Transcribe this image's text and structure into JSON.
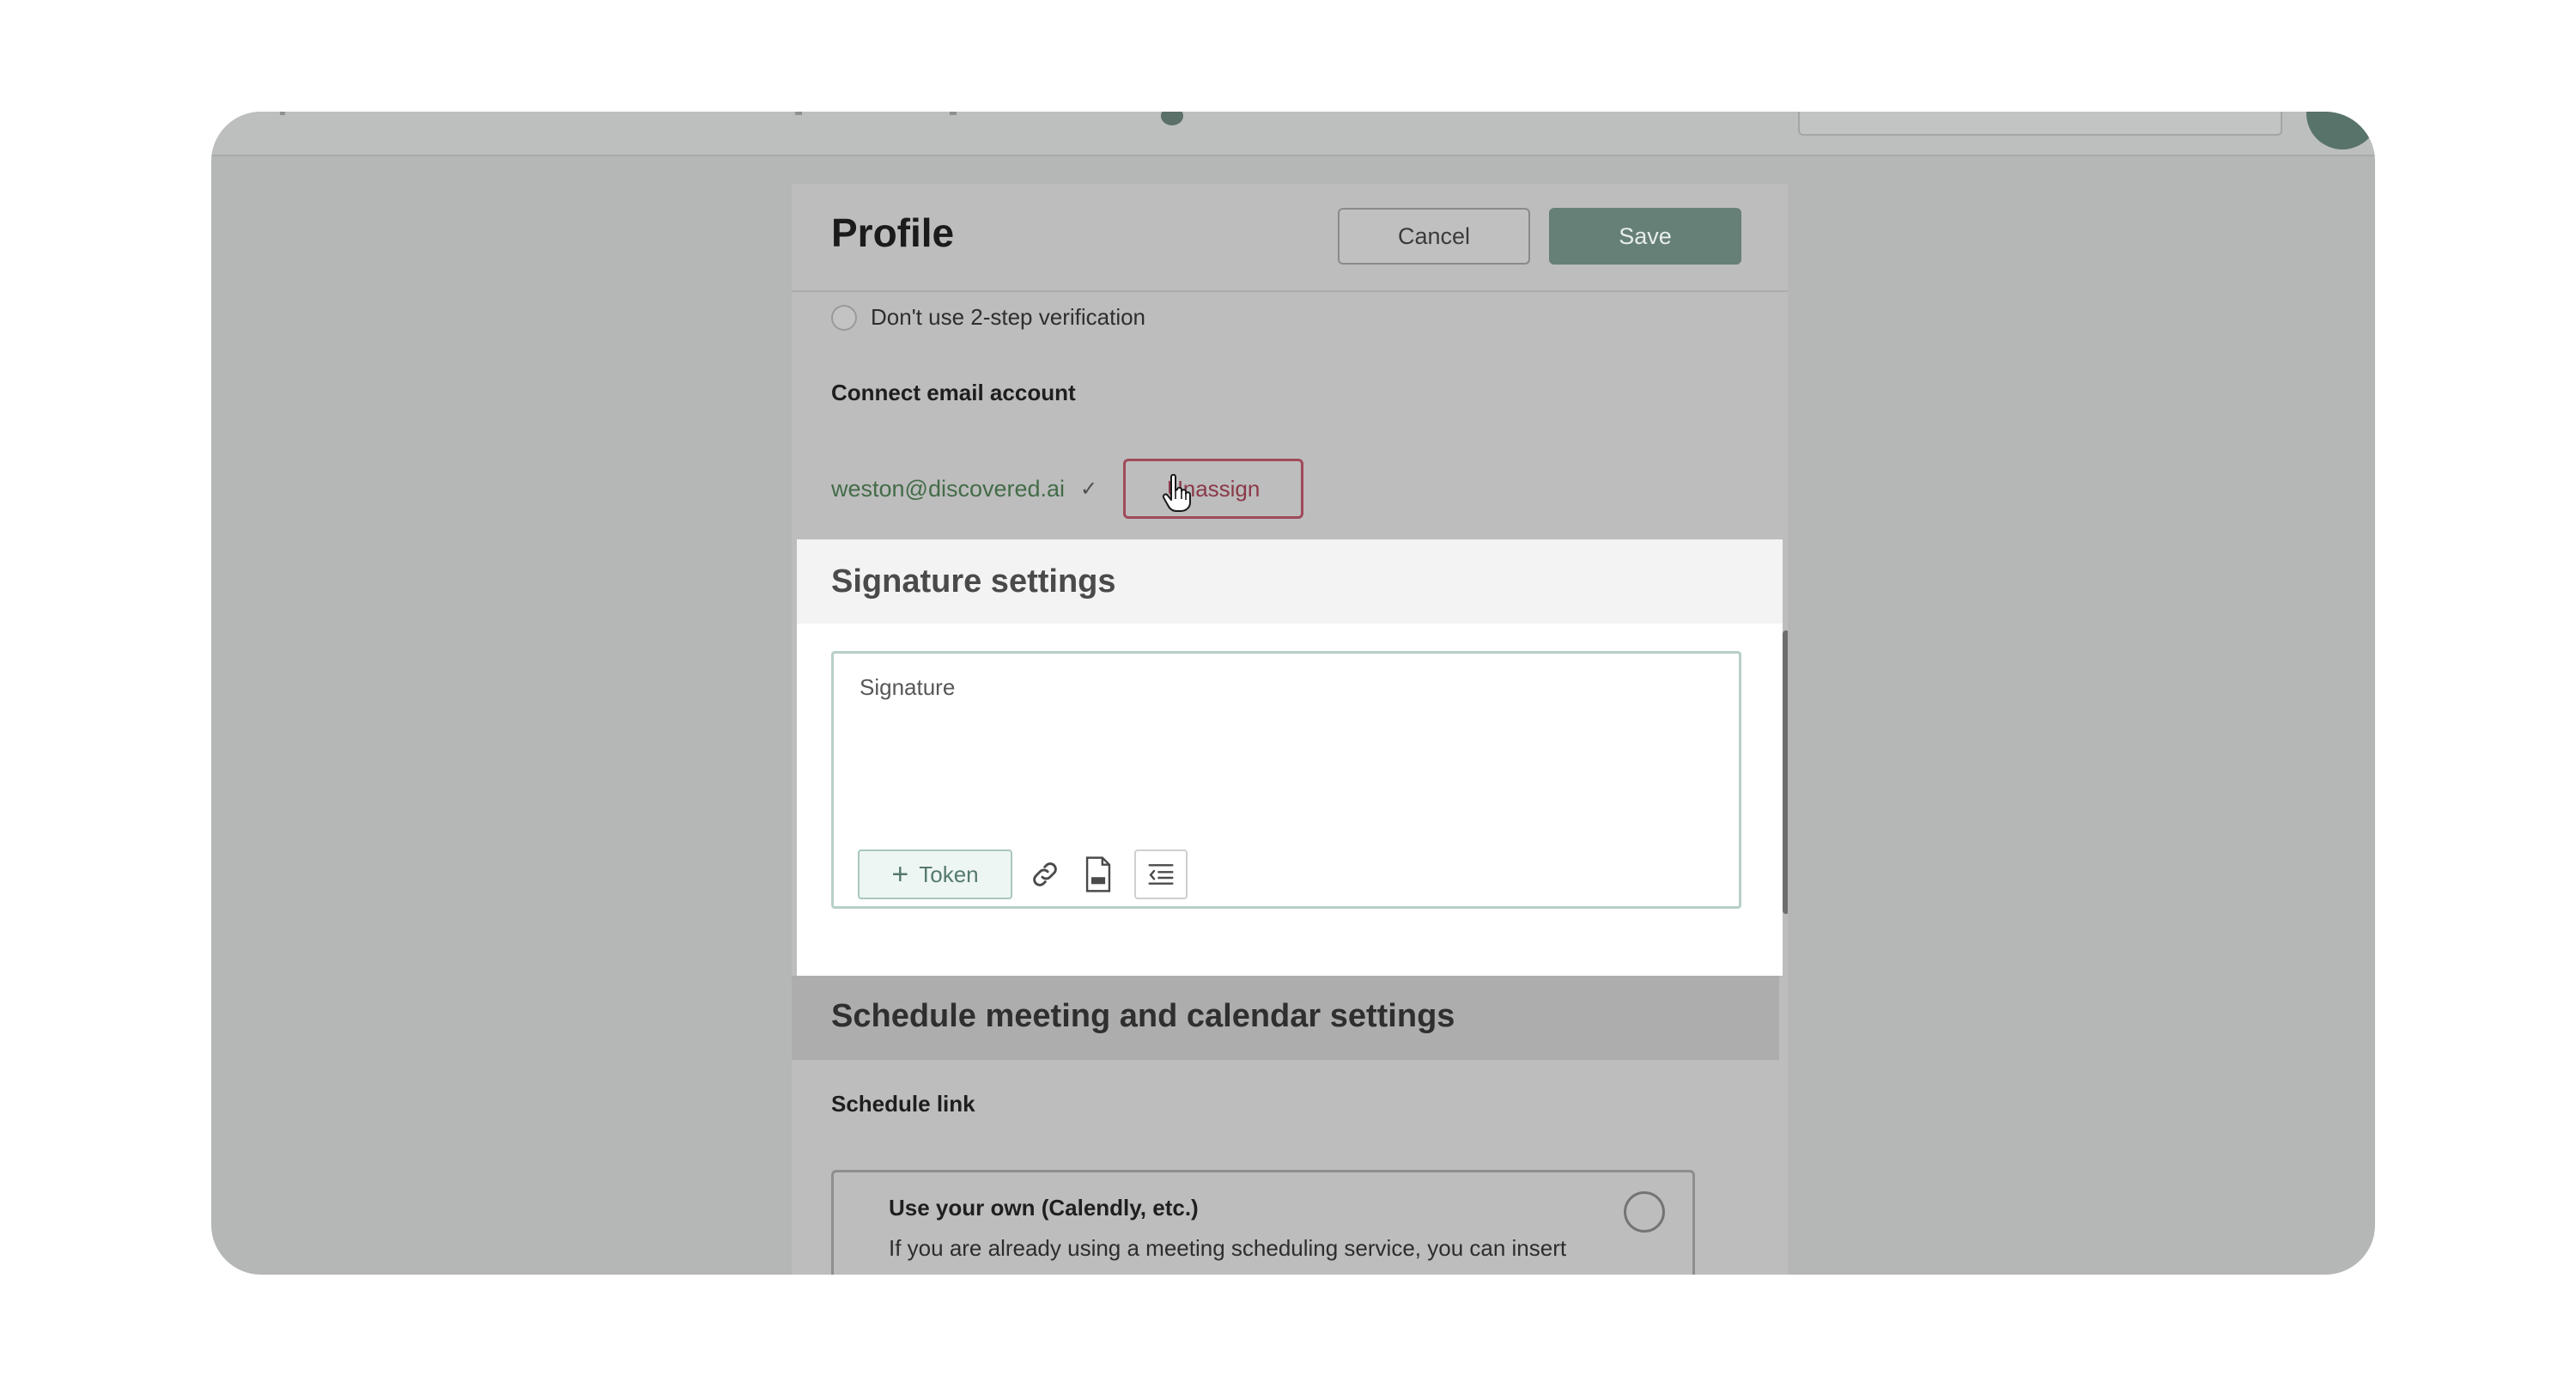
{
  "modal": {
    "title": "Profile",
    "cancel_label": "Cancel",
    "save_label": "Save"
  },
  "verification": {
    "option_label": "Don't use 2-step verification"
  },
  "email": {
    "section_label": "Connect email account",
    "address": "weston@discovered.ai",
    "check": "✓",
    "unassign_label": "Unassign"
  },
  "signature": {
    "section_title": "Signature settings",
    "placeholder": "Signature",
    "token_label": "Token",
    "token_plus": "+"
  },
  "calendar": {
    "section_title": "Schedule meeting and calendar settings",
    "schedule_link_label": "Schedule link",
    "option_title": "Use your own (Calendly, etc.)",
    "option_desc": "If you are already using a meeting scheduling service, you can insert your link and continue through it"
  },
  "icons": [
    "link-icon",
    "jpg-file-icon",
    "indent-icon",
    "hand-cursor-icon",
    "check-icon"
  ],
  "colors": {
    "overlay": "#b5b7b6",
    "save_button": "#667f77",
    "email_text": "#436c48",
    "unassign_border": "#a04a5a",
    "token_accent": "#557a6d"
  }
}
